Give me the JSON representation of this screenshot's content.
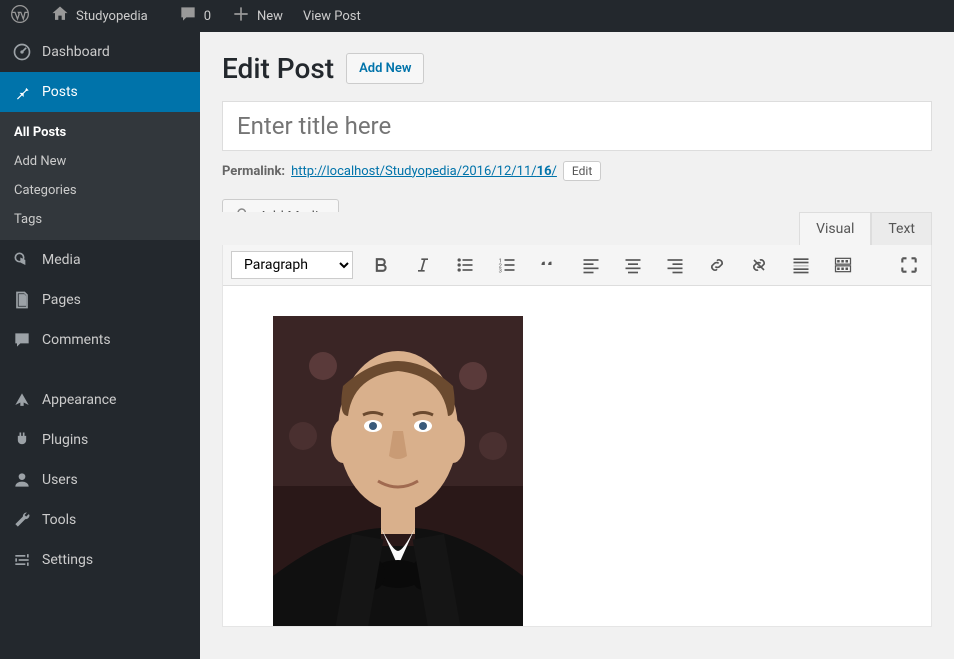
{
  "topbar": {
    "site_label": "Studyopedia",
    "comments_count": "0",
    "new_label": "New",
    "view_post_label": "View Post"
  },
  "sidebar": {
    "items": [
      {
        "icon": "dashboard",
        "label": "Dashboard"
      },
      {
        "icon": "pin",
        "label": "Posts",
        "active": true
      },
      {
        "icon": "media",
        "label": "Media"
      },
      {
        "icon": "pages",
        "label": "Pages"
      },
      {
        "icon": "comments",
        "label": "Comments"
      },
      {
        "icon": "appearance",
        "label": "Appearance"
      },
      {
        "icon": "plugins",
        "label": "Plugins"
      },
      {
        "icon": "users",
        "label": "Users"
      },
      {
        "icon": "tools",
        "label": "Tools"
      },
      {
        "icon": "settings",
        "label": "Settings"
      }
    ],
    "submenu": [
      "All Posts",
      "Add New",
      "Categories",
      "Tags"
    ]
  },
  "page": {
    "title": "Edit Post",
    "add_new_btn": "Add New",
    "title_placeholder": "Enter title here",
    "permalink_label": "Permalink:",
    "permalink_url_base": "http://localhost/Studyopedia/2016/12/11/",
    "permalink_slug": "16",
    "permalink_trail": "/",
    "edit_btn": "Edit",
    "add_media_btn": "Add Media",
    "editor_tabs": {
      "visual": "Visual",
      "text": "Text"
    },
    "format_select": "Paragraph"
  }
}
